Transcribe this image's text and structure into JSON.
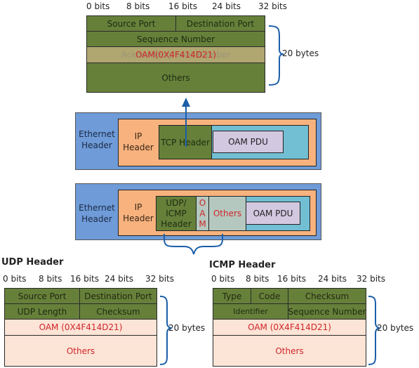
{
  "tcp_header": {
    "bit_labels": [
      "0 bits",
      "8 bits",
      "16 bits",
      "24 bits",
      "32 bits"
    ],
    "rows": {
      "source_port": "Source Port",
      "destination_port": "Destination Port",
      "sequence_number": "Sequence Number",
      "ack_number_faded": "Acknowledgment Number",
      "oam": "OAM(0X4F414D21)",
      "others": "Others"
    },
    "size_label": "20 bytes"
  },
  "tcp_packet": {
    "ethernet": "Ethernet Header",
    "ip": "IP Header",
    "tcp": "TCP Header",
    "payload": "OAM PDU"
  },
  "udp_icmp_packet": {
    "ethernet": "Ethernet Header",
    "ip": "IP Header",
    "l4": "UDP/ ICMP Header",
    "oam_vertical": [
      "O",
      "A",
      "M"
    ],
    "others": "Others",
    "payload": "OAM PDU"
  },
  "udp_header": {
    "title": "UDP Header",
    "bit_labels": [
      "0 bits",
      "8 bits",
      "16 bits",
      "24 bits",
      "32 bits"
    ],
    "rows": {
      "source_port": "Source Port",
      "destination_port": "Destination Port",
      "udp_length": "UDP Length",
      "checksum": "Checksum",
      "oam": "OAM (0X4F414D21)",
      "others": "Others"
    },
    "size_label": "20 bytes"
  },
  "icmp_header": {
    "title": "ICMP Header",
    "bit_labels": [
      "0 bits",
      "8 bits",
      "16 bits",
      "24 bits",
      "32 bits"
    ],
    "rows": {
      "type": "Type",
      "code": "Code",
      "checksum": "Checksum",
      "identifier": "Identifier",
      "sequence_number": "Sequence Number",
      "oam": "OAM (0X4F414D21)",
      "others": "Others"
    },
    "size_label": "20 bytes"
  },
  "colors": {
    "header_green": "#66803a",
    "oam_tan": "#b0a670",
    "ethernet_blue": "#6f9bd8",
    "ip_orange": "#f7b27e",
    "payload_teal": "#72bfd3",
    "oam_pdu_lilac": "#d2c8e0",
    "others_grey": "#b5c8bf",
    "oam_pink": "#fce4d6",
    "accent_red": "#d0262b",
    "bracket_blue": "#1a5ea8"
  }
}
